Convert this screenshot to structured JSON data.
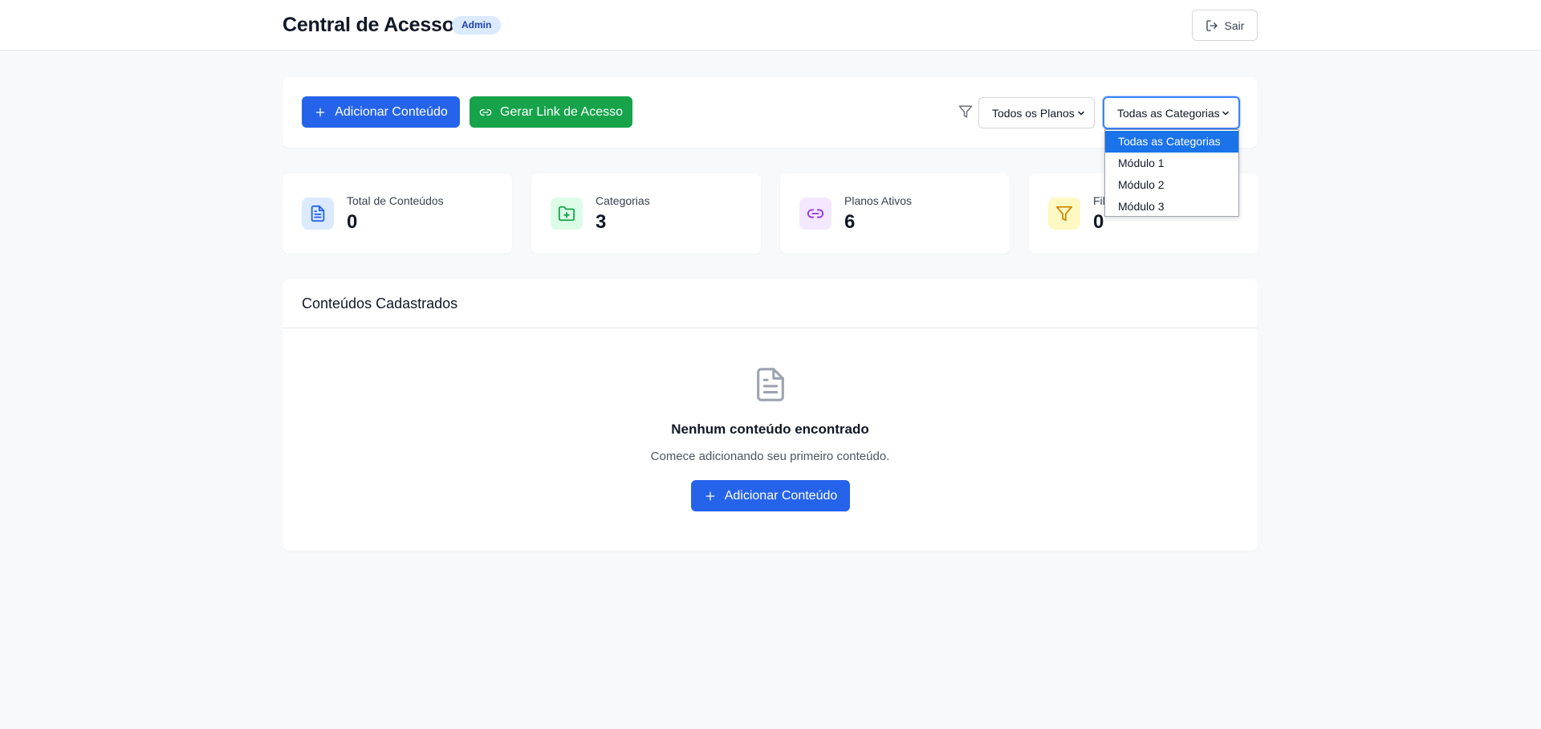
{
  "header": {
    "title": "Central de Acesso",
    "badge": "Admin",
    "logout_label": "Sair"
  },
  "toolbar": {
    "add_content_label": "Adicionar Conteúdo",
    "generate_link_label": "Gerar Link de Acesso",
    "plans_select": {
      "value": "Todos os Planos"
    },
    "categories_select": {
      "value": "Todas as Categorias",
      "options": [
        "Todas as Categorias",
        "Módulo 1",
        "Módulo 2",
        "Módulo 3"
      ],
      "selected_index": 0
    }
  },
  "stats": [
    {
      "label": "Total de Conteúdos",
      "value": "0",
      "icon": "document-icon",
      "color": "#2563eb",
      "bg": "#dbeafe"
    },
    {
      "label": "Categorias",
      "value": "3",
      "icon": "folder-plus-icon",
      "color": "#16a34a",
      "bg": "#dcfce7"
    },
    {
      "label": "Planos Ativos",
      "value": "6",
      "icon": "link-icon",
      "color": "#9333ea",
      "bg": "#f3e8ff"
    },
    {
      "label": "Fil",
      "value": "0",
      "icon": "filter-icon",
      "color": "#ca8a04",
      "bg": "#fef9c3"
    }
  ],
  "content_list": {
    "title": "Conteúdos Cadastrados",
    "empty_title": "Nenhum conteúdo encontrado",
    "empty_subtitle": "Comece adicionando seu primeiro conteúdo.",
    "empty_button_label": "Adicionar Conteúdo"
  },
  "colors": {
    "primary": "#2563eb",
    "success": "#16a34a",
    "background": "#f8f9fb"
  }
}
